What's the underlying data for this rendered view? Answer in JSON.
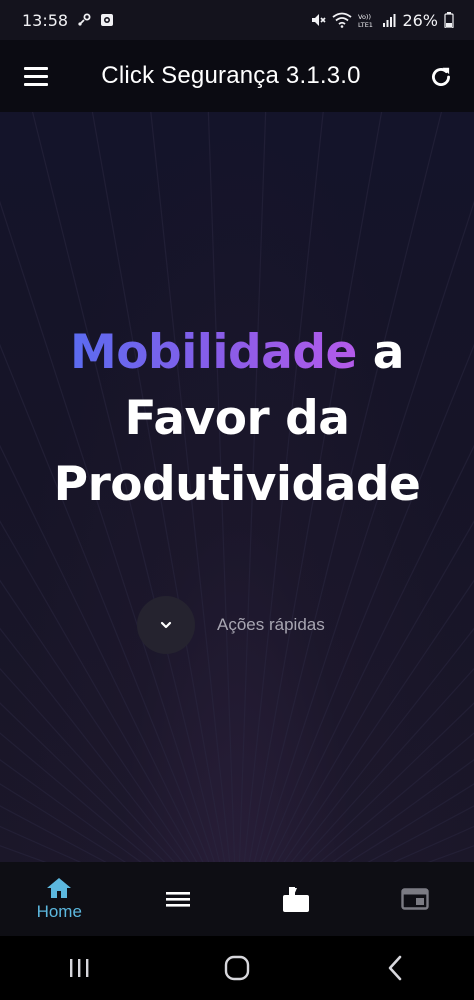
{
  "status_bar": {
    "time": "13:58",
    "battery": "26%",
    "left_icons": [
      "link-icon",
      "notification-app-icon"
    ],
    "right_icons": [
      "mute-icon",
      "wifi-icon",
      "volte-icon",
      "signal-icon",
      "battery-icon"
    ]
  },
  "app_bar": {
    "title": "Click Segurança 3.1.3.0",
    "left_icon": "menu-icon",
    "right_icon": "refresh-icon"
  },
  "hero": {
    "headline_accent": "Mobilidade",
    "headline_line1_rest": " a",
    "headline_line2": "Favor da",
    "headline_line3": "Produtividade",
    "quick_actions_label": "Ações rápidas",
    "quick_actions_icon": "chevron-down-icon",
    "accent_gradient": [
      "#5b6cf0",
      "#8b5ce8",
      "#b45bea"
    ]
  },
  "bottom_nav": {
    "items": [
      {
        "label": "Home",
        "icon": "home-icon",
        "active": true
      },
      {
        "label": "",
        "icon": "list-icon",
        "active": false
      },
      {
        "label": "",
        "icon": "clipboard-icon",
        "active": false
      },
      {
        "label": "",
        "icon": "window-icon",
        "active": false
      }
    ],
    "active_color": "#5cb8df"
  },
  "system_nav": {
    "icons": [
      "recents-icon",
      "home-circle-icon",
      "back-icon"
    ]
  },
  "colors": {
    "background": "#0c0b14",
    "app_bar": "#0b0b12",
    "bottom_nav": "#0e0e14",
    "accent": "#5cb8df"
  }
}
